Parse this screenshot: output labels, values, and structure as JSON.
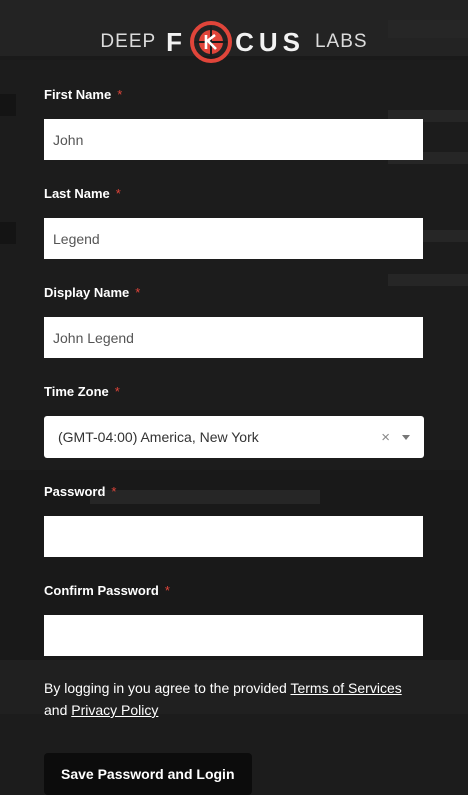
{
  "brand": {
    "left": "DEEP",
    "center": "FOCUS",
    "right": "LABS"
  },
  "fields": {
    "first_name": {
      "label": "First Name",
      "required": "*",
      "value": "John"
    },
    "last_name": {
      "label": "Last Name",
      "required": "*",
      "value": "Legend"
    },
    "display_name": {
      "label": "Display Name",
      "required": "*",
      "value": "John Legend"
    },
    "time_zone": {
      "label": "Time Zone",
      "required": "*",
      "value": "(GMT-04:00) America, New York",
      "clear": "×"
    },
    "password": {
      "label": "Password",
      "required": "*",
      "value": ""
    },
    "confirm_password": {
      "label": "Confirm Password",
      "required": "*",
      "value": ""
    }
  },
  "terms": {
    "prefix": "By logging in you agree to the provided ",
    "tos_link": "Terms of Services",
    "middle": " and ",
    "privacy_link": "Privacy Policy"
  },
  "submit_label": "Save Password and Login",
  "colors": {
    "background": "#1c1c1c",
    "required": "#e0453a",
    "logo_accent": "#e0453a"
  }
}
